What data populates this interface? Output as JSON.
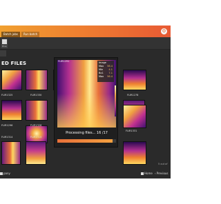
{
  "tabs": [
    {
      "label": "Batch jobs",
      "active": true
    },
    {
      "label": "Run batch",
      "active": false
    }
  ],
  "icons": {
    "settings": "gear-icon",
    "home": "home-icon",
    "previous": "chevron-left-icon",
    "back": "back-icon"
  },
  "toolbar": {
    "filter_label": "Blue"
  },
  "section_title": "ED FILES",
  "thumbnails": [
    {
      "label": "FLIR1325"
    },
    {
      "label": "FLIR1330"
    },
    {
      "label": "FLIR1278"
    },
    {
      "label": "FLIR1296"
    },
    {
      "label": "FLIR1328"
    },
    {
      "label": "FLIR1315"
    },
    {
      "label": "FLIR1331"
    },
    {
      "label": "FLIR1314"
    }
  ],
  "preview": {
    "label": "FLIR1291",
    "measurements": [
      {
        "name": "Image",
        "value": ""
      },
      {
        "name": "Max",
        "value": "56.4"
      },
      {
        "name": "Min",
        "value": "4.1"
      },
      {
        "name": "Bx1",
        "value": "7.1"
      },
      {
        "name": "Max",
        "value": "56.4"
      }
    ]
  },
  "processing": {
    "text": "Processing files... 16 /17",
    "progress": 0.94
  },
  "side_hint": "5 out of",
  "footer": {
    "left_label": "pany",
    "home_label": "Home",
    "previous_label": "Previous"
  },
  "colors": {
    "accent": "#EE8030",
    "window_bg": "#2A2A2A"
  }
}
